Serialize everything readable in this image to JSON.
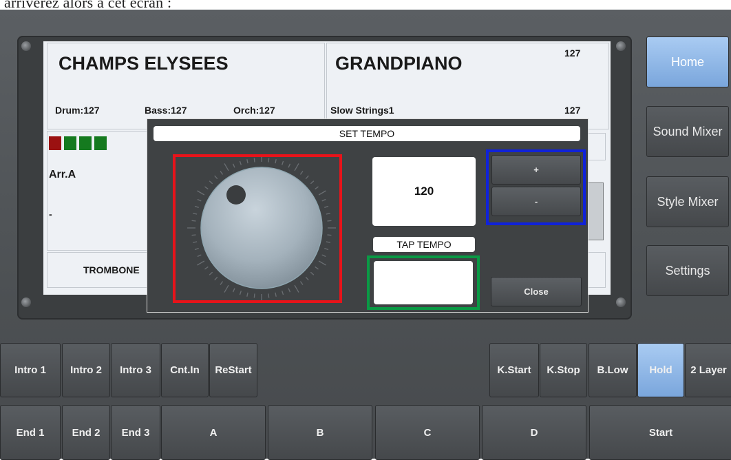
{
  "caption": "arriverez alors à cet écran :",
  "main_panel": {
    "style_name": "CHAMPS ELYSEES",
    "drum": "Drum:127",
    "bass": "Bass:127",
    "orch": "Orch:127",
    "arrangement": "Arr.A",
    "dash": "-",
    "bottom_voice": "TROMBONE"
  },
  "voice_panel": {
    "voice_name": "GRANDPIANO",
    "voice_volume": "127",
    "layer_name": "Slow Strings1",
    "layer_volume": "127"
  },
  "indicator_colors": [
    "#9b1111",
    "#157a1f",
    "#157a1f",
    "#157a1f"
  ],
  "side_menu": [
    {
      "label": "Home",
      "active": true
    },
    {
      "label": "Sound Mixer",
      "active": false
    },
    {
      "label": "Style Mixer",
      "active": false
    },
    {
      "label": "Settings",
      "active": false
    }
  ],
  "dialog": {
    "title": "SET TEMPO",
    "tempo_value": "120",
    "plus_label": "+",
    "minus_label": "-",
    "tap_tempo_label": "TAP TEMPO",
    "close_label": "Close"
  },
  "buttons_row1": {
    "intro1": "Intro 1",
    "intro2": "Intro 2",
    "intro3": "Intro 3",
    "cntin": "Cnt.In",
    "restart": "ReStart",
    "kstart": "K.Start",
    "kstop": "K.Stop",
    "blow": "B.Low",
    "hold": "Hold",
    "layer2": "2 Layer"
  },
  "buttons_row2": {
    "end1": "End 1",
    "end2": "End 2",
    "end3": "End 3",
    "a": "A",
    "b": "B",
    "c": "C",
    "d": "D",
    "start": "Start"
  }
}
